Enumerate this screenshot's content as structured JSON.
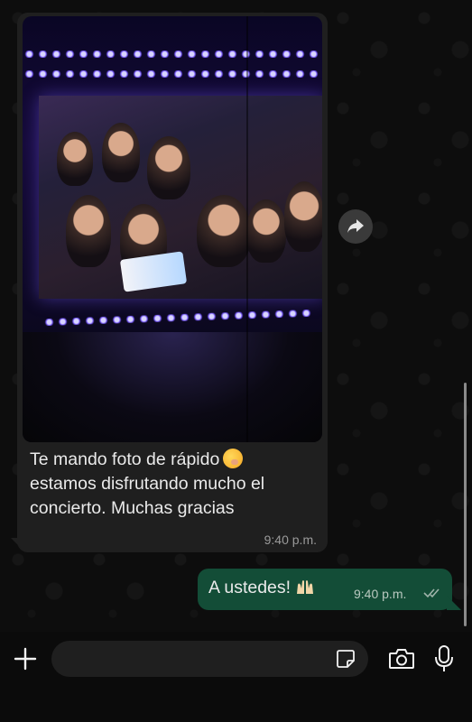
{
  "chat": {
    "incoming": {
      "caption_lines": [
        "Te mando foto de rápido",
        "estamos disfrutando mucho el",
        "concierto. Muchas gracias"
      ],
      "emoji": "face-with-hand-over-mouth",
      "time": "9:40 p.m."
    },
    "outgoing": {
      "text": "A ustedes!",
      "emoji": "raising-hands",
      "time": "9:40 p.m.",
      "status": "read-double-check"
    }
  },
  "input_bar": {
    "placeholder": "",
    "icons": [
      "plus-icon",
      "sticker-icon",
      "camera-icon",
      "microphone-icon"
    ]
  },
  "colors": {
    "chat_bg": "#0d0d0d",
    "incoming_bubble": "#1f1f1f",
    "outgoing_bubble": "#134d37",
    "text": "#eaeaea",
    "meta_text": "#9a9a9a"
  }
}
